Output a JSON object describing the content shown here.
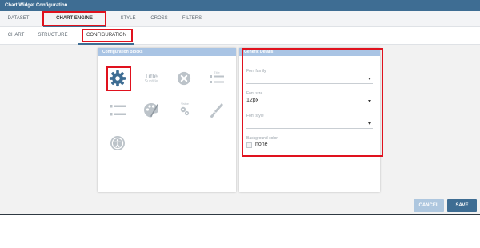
{
  "window": {
    "title": "Chart Widget Configuration"
  },
  "main_tabs": [
    {
      "label": "DATASET"
    },
    {
      "label": "CHART ENGINE DESIGNER"
    },
    {
      "label": "STYLE"
    },
    {
      "label": "CROSS"
    },
    {
      "label": "FILTERS"
    }
  ],
  "sub_tabs": [
    {
      "label": "CHART"
    },
    {
      "label": "STRUCTURE"
    },
    {
      "label": "CONFIGURATION"
    }
  ],
  "blocks_panel": {
    "title": "Configuration Blocks",
    "blocks": [
      {
        "icon": "gear-icon"
      },
      {
        "icon": "title-subtitle-icon",
        "title": "Title",
        "subtitle": "Subtitle"
      },
      {
        "icon": "no-data-icon"
      },
      {
        "icon": "legend-title-icon",
        "title": "Title"
      },
      {
        "icon": "legend-list-icon"
      },
      {
        "icon": "palette-icon"
      },
      {
        "icon": "advanced-settings-icon",
        "title": "Value"
      },
      {
        "icon": "brush-icon"
      },
      {
        "icon": "accessibility-icon"
      }
    ]
  },
  "details_panel": {
    "title": "Generic Details",
    "font_family": {
      "label": "Font family",
      "value": ""
    },
    "font_size": {
      "label": "Font size",
      "value": "12px"
    },
    "font_style": {
      "label": "Font style",
      "value": ""
    },
    "background_color": {
      "label": "Background color",
      "value": "none"
    }
  },
  "footer": {
    "cancel_label": "CANCEL",
    "save_label": "SAVE"
  },
  "colors": {
    "accent": "#3e6d93",
    "highlight": "#e0121e",
    "panel_header": "#a9c4e4",
    "icon_muted": "#bcc3c9"
  }
}
